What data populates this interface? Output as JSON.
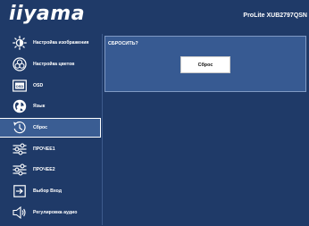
{
  "brand": {
    "logo": "iiyama",
    "model": "ProLite XUB2797QSN"
  },
  "menu": {
    "items": [
      {
        "label": "Настройка изображения",
        "icon": "brightness-icon"
      },
      {
        "label": "Настройка цветов",
        "icon": "color-palette-icon"
      },
      {
        "label": "OSD",
        "icon": "osd-icon"
      },
      {
        "label": "Язык",
        "icon": "globe-icon"
      },
      {
        "label": "Сброс",
        "icon": "reset-icon",
        "selected": true
      },
      {
        "label": "ПРОЧЕЕ1",
        "icon": "sliders-icon"
      },
      {
        "label": "ПРОЧЕЕ2",
        "icon": "sliders-icon"
      },
      {
        "label": "Выбор Вход",
        "icon": "input-icon"
      },
      {
        "label": "Регулировка аудио",
        "icon": "speaker-icon"
      }
    ]
  },
  "panel": {
    "question": "СБРОСИТЬ?",
    "button_label": "Сброс"
  },
  "colors": {
    "background": "#1f3a68",
    "panel": "#375a92",
    "selected": "#3a5d93",
    "text": "#ffffff"
  }
}
